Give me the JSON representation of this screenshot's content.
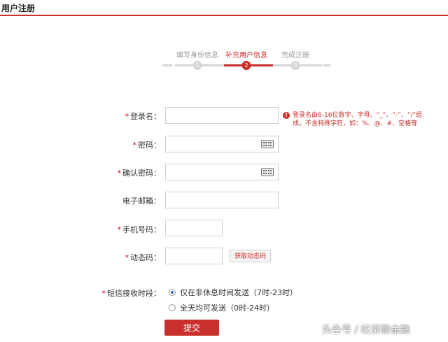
{
  "page": {
    "title": "用户注册"
  },
  "stepper": {
    "steps": [
      {
        "label": "填写身份信息",
        "number": "1",
        "active": false
      },
      {
        "label": "补充用户信息",
        "number": "2",
        "active": true
      },
      {
        "label": "完成注册",
        "number": "3",
        "active": false
      }
    ]
  },
  "form": {
    "required_mark": "*",
    "username": {
      "label": "登录名：",
      "value": "",
      "placeholder": ""
    },
    "password": {
      "label": "密码：",
      "value": ""
    },
    "confirm_password": {
      "label": "确认密码：",
      "value": ""
    },
    "email": {
      "label": "电子邮箱：",
      "value": ""
    },
    "phone": {
      "label": "手机号码：",
      "value": ""
    },
    "sms_code": {
      "label": "动态码：",
      "value": "",
      "button_label": "获取动态码"
    },
    "sms_time": {
      "label": "短信接收时段：",
      "options": [
        {
          "label": "仅在非休息时间发送（7时-23时）",
          "checked": true
        },
        {
          "label": "全天均可发送（0时-24时）",
          "checked": false
        }
      ]
    },
    "submit_label": "提交"
  },
  "hint": {
    "icon": "!",
    "text": "登录名由6-16位数字、字母、“_”、“-”、“/”组成，不含特殊字符，如：%、@、#、空格等"
  },
  "watermark": {
    "text": "头条号 / 叹茶聊金融"
  },
  "colors": {
    "accent": "#c9302c",
    "inactive": "#d6d6d6"
  }
}
